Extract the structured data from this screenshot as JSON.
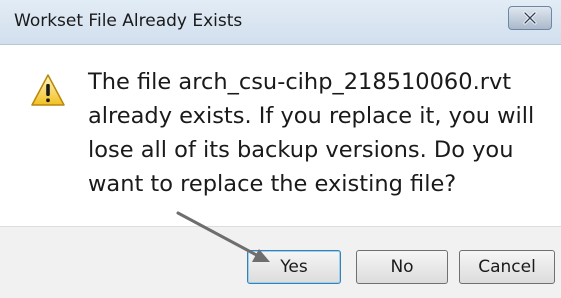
{
  "window": {
    "title": "Workset File Already Exists",
    "close_icon": "close-icon"
  },
  "message": {
    "icon": "warning-icon",
    "text": "The file arch_csu-cihp_218510060.rvt already exists.  If you replace it, you will lose all of its backup versions. Do you want to replace the existing file?"
  },
  "buttons": {
    "yes": "Yes",
    "no": "No",
    "cancel": "Cancel"
  },
  "annotation": {
    "arrow_target": "Yes",
    "arrow_color": "#6e6e6e"
  }
}
